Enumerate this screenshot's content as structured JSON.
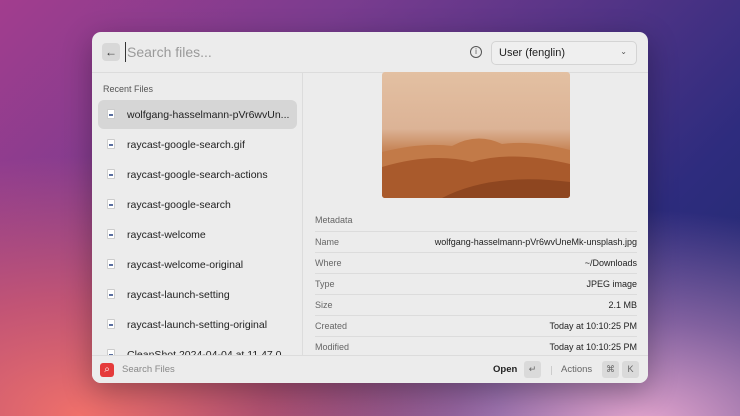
{
  "header": {
    "back_icon": "arrow-left",
    "search_placeholder": "Search files...",
    "info_icon": "info-circle",
    "scope": "User (fenglin)"
  },
  "sidebar": {
    "section": "Recent Files",
    "items": [
      {
        "label": "wolfgang-hasselmann-pVr6wvUn...",
        "selected": true
      },
      {
        "label": "raycast-google-search.gif"
      },
      {
        "label": "raycast-google-search-actions"
      },
      {
        "label": "raycast-google-search"
      },
      {
        "label": "raycast-welcome"
      },
      {
        "label": "raycast-welcome-original"
      },
      {
        "label": "raycast-launch-setting"
      },
      {
        "label": "raycast-launch-setting-original"
      },
      {
        "label": "CleanShot 2024-04-04 at 11.47.0"
      }
    ]
  },
  "detail": {
    "metadata_title": "Metadata",
    "rows": [
      {
        "k": "Name",
        "v": "wolfgang-hasselmann-pVr6wvUneMk-unsplash.jpg"
      },
      {
        "k": "Where",
        "v": "~/Downloads"
      },
      {
        "k": "Type",
        "v": "JPEG image"
      },
      {
        "k": "Size",
        "v": "2.1 MB"
      },
      {
        "k": "Created",
        "v": "Today at 10:10:25 PM"
      },
      {
        "k": "Modified",
        "v": "Today at 10:10:25 PM"
      }
    ]
  },
  "footer": {
    "command": "Search Files",
    "primary": "Open",
    "enter_key": "↵",
    "actions": "Actions",
    "cmd_key": "⌘",
    "k_key": "K"
  },
  "colors": {
    "accent": "#e53b3b"
  }
}
